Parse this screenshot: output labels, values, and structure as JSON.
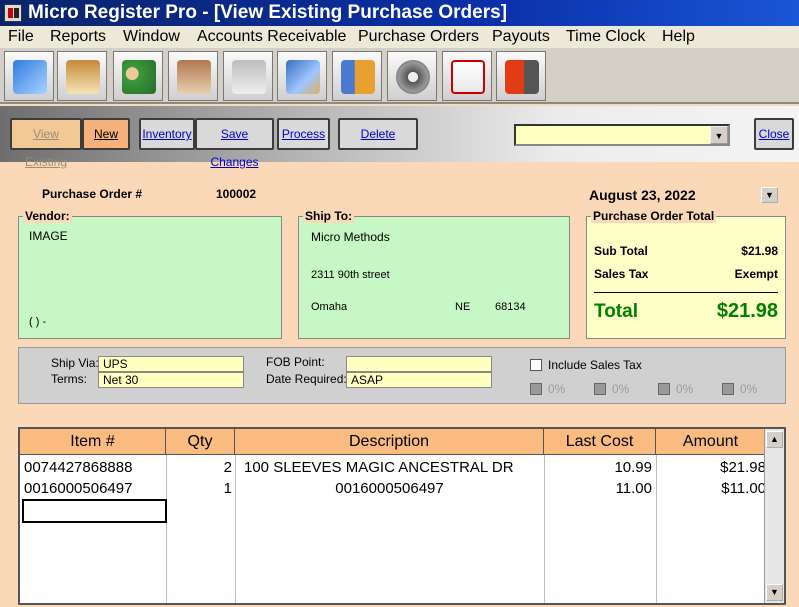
{
  "window": {
    "title": "Micro Register Pro - [View Existing Purchase Orders]"
  },
  "menu": [
    "File",
    "Reports",
    "Window",
    "Accounts Receivable",
    "Purchase Orders",
    "Payouts",
    "Time Clock",
    "Help"
  ],
  "toolbar_icons": [
    "notepad-icon",
    "clipboard-icon",
    "users-icon",
    "customer-card-icon",
    "register-icon",
    "warehouse-icon",
    "price-list-icon",
    "gear-icon",
    "paid-invoice-icon",
    "exit-icon"
  ],
  "commands": {
    "view_existing": "View Existing",
    "new": "New",
    "inventory": "Inventory",
    "save_changes": "Save Changes",
    "process": "Process",
    "delete": "Delete",
    "close": "Close",
    "combo_value": ""
  },
  "po": {
    "number_label": "Purchase Order #",
    "number": "100002",
    "date": "August  23, 2022"
  },
  "vendor": {
    "title": "Vendor:",
    "name": "IMAGE",
    "phone": "(   )   -"
  },
  "ship_to": {
    "title": "Ship To:",
    "name": "Micro Methods",
    "street": "2311 90th street",
    "city": "Omaha",
    "state": "NE",
    "zip": "68134"
  },
  "totals": {
    "title": "Purchase Order Total",
    "subtotal_label": "Sub Total",
    "subtotal": "$21.98",
    "tax_label": "Sales Tax",
    "tax": "Exempt",
    "total_label": "Total",
    "total": "$21.98"
  },
  "shipping": {
    "ship_via_label": "Ship Via:",
    "ship_via": "UPS",
    "terms_label": "Terms:",
    "terms": "Net 30",
    "fob_label": "FOB Point:",
    "fob": "",
    "date_required_label": "Date Required:",
    "date_required": "ASAP",
    "include_tax_label": "Include Sales Tax",
    "tax_rates": [
      "0%",
      "0%",
      "0%",
      "0%"
    ]
  },
  "grid": {
    "columns": [
      "Item #",
      "Qty",
      "Description",
      "Last Cost",
      "Amount"
    ],
    "rows": [
      [
        "0074427868888",
        "2",
        "100 SLEEVES MAGIC ANCESTRAL DR",
        "10.99",
        "$21.98"
      ],
      [
        "0016000506497",
        "1",
        "0016000506497",
        "11.00",
        "$11.00"
      ]
    ]
  },
  "colors": {
    "background": "#fbd9b8",
    "green_panel": "#c6f7c4",
    "yellow_panel": "#ffffc8",
    "total_green": "#008000",
    "grid_header": "#f9bb80"
  }
}
